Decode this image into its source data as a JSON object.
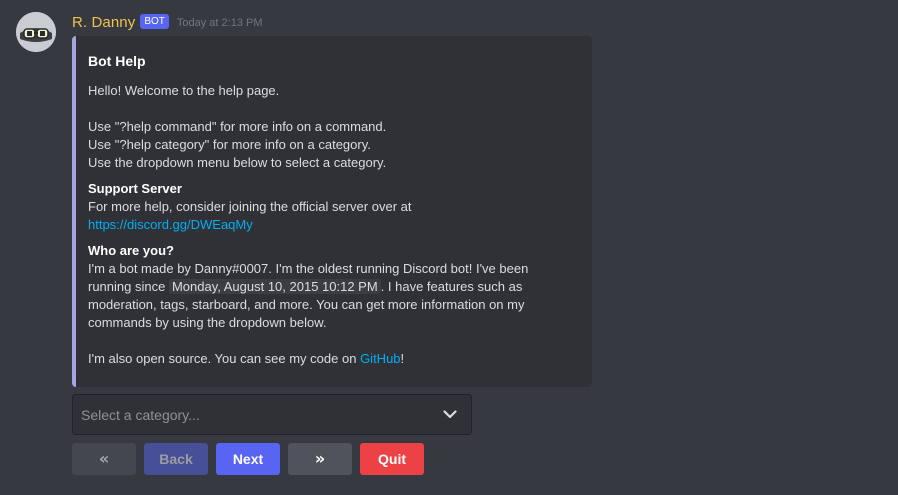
{
  "message": {
    "author": "R. Danny",
    "bot_tag": "BOT",
    "timestamp": "Today at 2:13 PM",
    "avatar_icon": "goggles-avatar-icon"
  },
  "embed": {
    "accent_color": "#a3a6e3",
    "title": "Bot Help",
    "description": {
      "intro": "Hello! Welcome to the help page.",
      "lines": [
        "Use \"?help command\" for more info on a command.",
        "Use \"?help category\" for more info on a category.",
        "Use the dropdown menu below to select a category."
      ]
    },
    "fields": {
      "support": {
        "name": "Support Server",
        "line1": "For more help, consider joining the official server over at",
        "link": "https://discord.gg/DWEaqMy"
      },
      "who": {
        "name": "Who are you?",
        "line1": "I'm a bot made by Danny#0007. I'm the oldest running Discord bot! I've been",
        "line2_pre": "running since",
        "line2_time": "Monday, August 10, 2015 10:12 PM",
        "line2_post": ". I have features such as",
        "line3": "moderation, tags, starboard, and more. You can get more information on my",
        "line4": "commands by using the dropdown below.",
        "line5_pre": "I'm also open source. You can see my code on",
        "line5_link": "GitHub",
        "line5_post": "!"
      }
    }
  },
  "dropdown": {
    "placeholder": "Select a category...",
    "icon": "chevron-down-icon"
  },
  "buttons": {
    "first": {
      "glyph": "«",
      "icon": "double-chevron-left-icon",
      "disabled": true
    },
    "back": {
      "label": "Back",
      "disabled": true
    },
    "next": {
      "label": "Next"
    },
    "last": {
      "glyph": "»",
      "icon": "double-chevron-right-icon"
    },
    "quit": {
      "label": "Quit"
    }
  },
  "colors": {
    "background": "#36393f",
    "embed_background": "#2f3136",
    "username": "#f0c24e",
    "blurple": "#5865f2",
    "red": "#ed4245",
    "grey": "#4f545c",
    "link": "#00aff4"
  }
}
